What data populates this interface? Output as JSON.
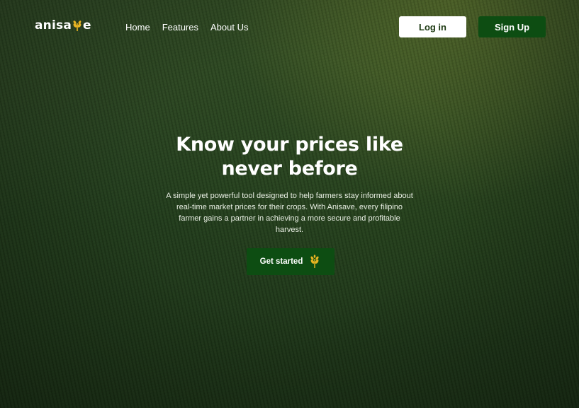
{
  "brand": {
    "logo_text_before": "anisa",
    "logo_text_after": "e",
    "logo_icon": "wheat-icon",
    "accent_color": "#e8b422"
  },
  "nav": {
    "links": [
      "Home",
      "Features",
      "About Us"
    ],
    "login_label": "Log in",
    "signup_label": "Sign Up"
  },
  "hero": {
    "title_line1": "Know your prices like",
    "title_line2": "never before",
    "subtitle": "A simple yet powerful tool designed to help farmers stay informed about real-time market prices for their crops. With Anisave, every filipino farmer gains a partner in achieving a more secure and profitable harvest.",
    "cta_label": "Get started",
    "cta_icon": "wheat-icon"
  },
  "colors": {
    "primary_green": "#0d4d12",
    "login_bg": "#ffffff",
    "text_white": "#ffffff"
  }
}
